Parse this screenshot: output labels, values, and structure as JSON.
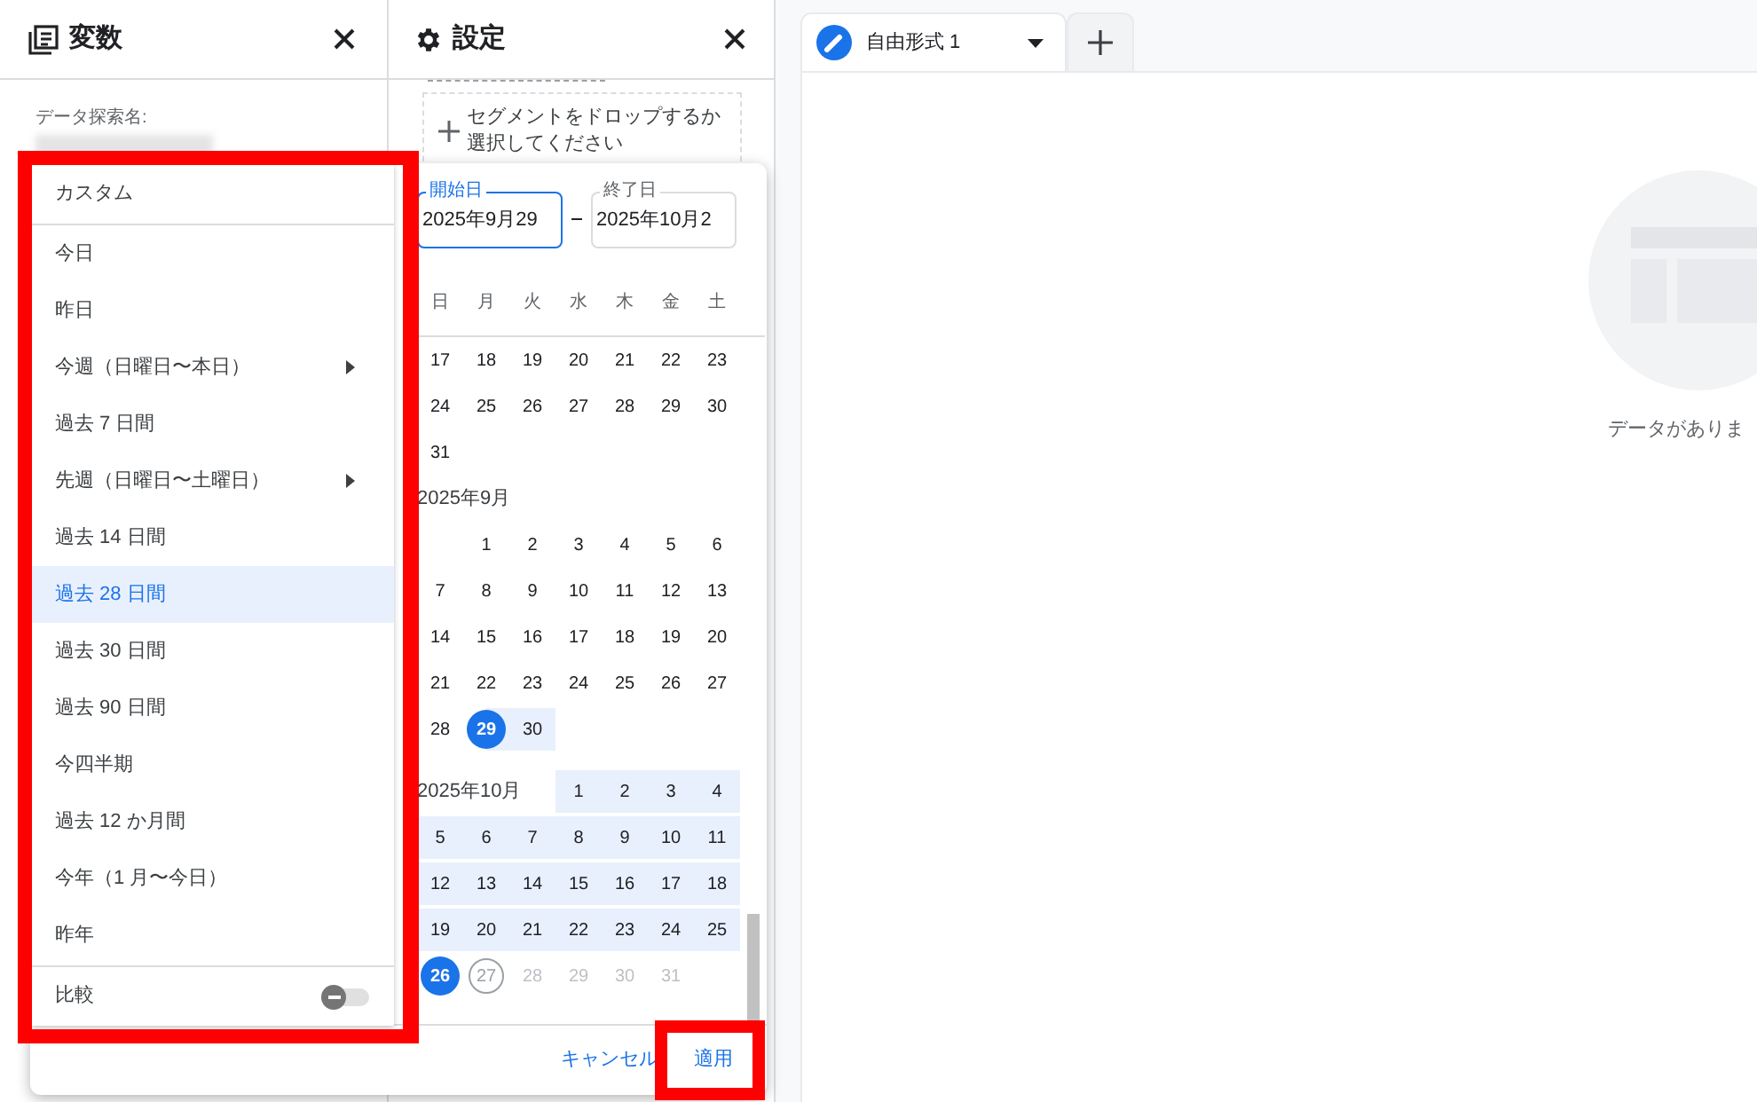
{
  "panels": {
    "variables": {
      "title": "変数",
      "exploration_label": "データ探索名:"
    },
    "settings": {
      "title": "設定",
      "segment_drop": "セグメントをドロップするか選択してください"
    }
  },
  "date_menu": {
    "items": [
      {
        "label": "カスタム",
        "selected": false,
        "submenu": false
      },
      {
        "label": "今日",
        "selected": false,
        "submenu": false
      },
      {
        "label": "昨日",
        "selected": false,
        "submenu": false
      },
      {
        "label": "今週（日曜日〜本日）",
        "selected": false,
        "submenu": true
      },
      {
        "label": "過去 7 日間",
        "selected": false,
        "submenu": false
      },
      {
        "label": "先週（日曜日〜土曜日）",
        "selected": false,
        "submenu": true
      },
      {
        "label": "過去 14 日間",
        "selected": false,
        "submenu": false
      },
      {
        "label": "過去 28 日間",
        "selected": true,
        "submenu": false
      },
      {
        "label": "過去 30 日間",
        "selected": false,
        "submenu": false
      },
      {
        "label": "過去 90 日間",
        "selected": false,
        "submenu": false
      },
      {
        "label": "今四半期",
        "selected": false,
        "submenu": false
      },
      {
        "label": "過去 12 か月間",
        "selected": false,
        "submenu": false
      },
      {
        "label": "今年（1 月〜今日）",
        "selected": false,
        "submenu": false
      },
      {
        "label": "昨年",
        "selected": false,
        "submenu": false
      }
    ],
    "compare": {
      "label": "比較",
      "on": false
    }
  },
  "date_picker": {
    "start": {
      "label": "開始日",
      "value": "2025年9月29"
    },
    "end": {
      "label": "終了日",
      "value": "2025年10月2"
    },
    "weekdays": [
      "日",
      "月",
      "火",
      "水",
      "木",
      "金",
      "土"
    ],
    "months": [
      {
        "weeks": [
          [
            {
              "day": "17",
              "kind": "plain"
            },
            {
              "day": "18",
              "kind": "plain"
            },
            {
              "day": "19",
              "kind": "plain"
            },
            {
              "day": "20",
              "kind": "plain"
            },
            {
              "day": "21",
              "kind": "plain"
            },
            {
              "day": "22",
              "kind": "plain"
            },
            {
              "day": "23",
              "kind": "plain"
            }
          ],
          [
            {
              "day": "24",
              "kind": "plain"
            },
            {
              "day": "25",
              "kind": "plain"
            },
            {
              "day": "26",
              "kind": "plain"
            },
            {
              "day": "27",
              "kind": "plain"
            },
            {
              "day": "28",
              "kind": "plain"
            },
            {
              "day": "29",
              "kind": "plain"
            },
            {
              "day": "30",
              "kind": "plain"
            }
          ],
          [
            {
              "day": "31",
              "kind": "plain"
            },
            {
              "kind": "blank"
            },
            {
              "kind": "blank"
            },
            {
              "kind": "blank"
            },
            {
              "kind": "blank"
            },
            {
              "kind": "blank"
            },
            {
              "kind": "blank"
            }
          ]
        ]
      },
      {
        "label": "2025年9月",
        "weeks": [
          [
            {
              "kind": "blank"
            },
            {
              "day": "1",
              "kind": "plain"
            },
            {
              "day": "2",
              "kind": "plain"
            },
            {
              "day": "3",
              "kind": "plain"
            },
            {
              "day": "4",
              "kind": "plain"
            },
            {
              "day": "5",
              "kind": "plain"
            },
            {
              "day": "6",
              "kind": "plain"
            }
          ],
          [
            {
              "day": "7",
              "kind": "plain"
            },
            {
              "day": "8",
              "kind": "plain"
            },
            {
              "day": "9",
              "kind": "plain"
            },
            {
              "day": "10",
              "kind": "plain"
            },
            {
              "day": "11",
              "kind": "plain"
            },
            {
              "day": "12",
              "kind": "plain"
            },
            {
              "day": "13",
              "kind": "plain"
            }
          ],
          [
            {
              "day": "14",
              "kind": "plain"
            },
            {
              "day": "15",
              "kind": "plain"
            },
            {
              "day": "16",
              "kind": "plain"
            },
            {
              "day": "17",
              "kind": "plain"
            },
            {
              "day": "18",
              "kind": "plain"
            },
            {
              "day": "19",
              "kind": "plain"
            },
            {
              "day": "20",
              "kind": "plain"
            }
          ],
          [
            {
              "day": "21",
              "kind": "plain"
            },
            {
              "day": "22",
              "kind": "plain"
            },
            {
              "day": "23",
              "kind": "plain"
            },
            {
              "day": "24",
              "kind": "plain"
            },
            {
              "day": "25",
              "kind": "plain"
            },
            {
              "day": "26",
              "kind": "plain"
            },
            {
              "day": "27",
              "kind": "plain"
            }
          ],
          [
            {
              "day": "28",
              "kind": "plain"
            },
            {
              "day": "29",
              "kind": "start"
            },
            {
              "day": "30",
              "kind": "range"
            },
            {
              "kind": "blank"
            },
            {
              "kind": "blank"
            },
            {
              "kind": "blank"
            },
            {
              "kind": "blank"
            }
          ]
        ]
      },
      {
        "label": "2025年10月",
        "weeks": [
          [
            {
              "kind": "blank"
            },
            {
              "kind": "blank"
            },
            {
              "kind": "blank"
            },
            {
              "day": "1",
              "kind": "range"
            },
            {
              "day": "2",
              "kind": "range"
            },
            {
              "day": "3",
              "kind": "range"
            },
            {
              "day": "4",
              "kind": "range"
            }
          ],
          [
            {
              "day": "5",
              "kind": "range"
            },
            {
              "day": "6",
              "kind": "range"
            },
            {
              "day": "7",
              "kind": "range"
            },
            {
              "day": "8",
              "kind": "range"
            },
            {
              "day": "9",
              "kind": "range"
            },
            {
              "day": "10",
              "kind": "range"
            },
            {
              "day": "11",
              "kind": "range"
            }
          ],
          [
            {
              "day": "12",
              "kind": "range"
            },
            {
              "day": "13",
              "kind": "range"
            },
            {
              "day": "14",
              "kind": "range"
            },
            {
              "day": "15",
              "kind": "range"
            },
            {
              "day": "16",
              "kind": "range"
            },
            {
              "day": "17",
              "kind": "range"
            },
            {
              "day": "18",
              "kind": "range"
            }
          ],
          [
            {
              "day": "19",
              "kind": "range"
            },
            {
              "day": "20",
              "kind": "range"
            },
            {
              "day": "21",
              "kind": "range"
            },
            {
              "day": "22",
              "kind": "range"
            },
            {
              "day": "23",
              "kind": "range"
            },
            {
              "day": "24",
              "kind": "range"
            },
            {
              "day": "25",
              "kind": "range"
            }
          ],
          [
            {
              "day": "26",
              "kind": "end"
            },
            {
              "day": "27",
              "kind": "today"
            },
            {
              "day": "28",
              "kind": "future"
            },
            {
              "day": "29",
              "kind": "future"
            },
            {
              "day": "30",
              "kind": "future"
            },
            {
              "day": "31",
              "kind": "future"
            },
            {
              "kind": "blank"
            }
          ]
        ]
      }
    ],
    "buttons": {
      "cancel": "キャンセル",
      "apply": "適用"
    }
  },
  "canvas": {
    "tabs": [
      {
        "label": "自由形式 1",
        "selected": true
      }
    ],
    "empty_message": "データがありま"
  }
}
